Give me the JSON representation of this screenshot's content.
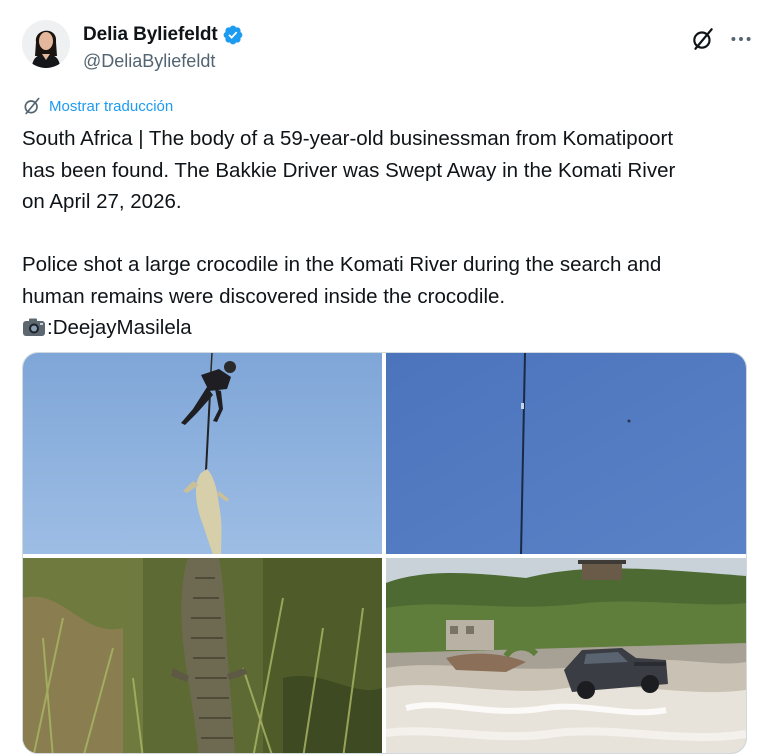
{
  "author": {
    "display_name": "Delia Byliefeldt",
    "handle": "@DeliaByliefeldt",
    "verified": true,
    "verified_color": "#1d9bf0"
  },
  "actions": {
    "grok_icon": "grok-icon",
    "more_icon": "more-icon"
  },
  "translate": {
    "label": "Mostrar traducción",
    "icon": "translate-icon",
    "color": "#1d9bf0"
  },
  "tweet": {
    "lines": [
      "South Africa | The body of a 59-year-old businessman from Komatipoort",
      "has been found.  The Bakkie Driver was Swept Away in the Komati River",
      "on April 27, 2026.",
      "Police shot a large crocodile in the Komati River during the search and",
      "human remains were discovered inside the crocodile."
    ],
    "credit_icon": "camera-icon",
    "credit": ":DeejayMasilela"
  },
  "media": {
    "count": 4,
    "images": [
      {
        "icon": "photo-crocodile-airlift"
      },
      {
        "icon": "photo-sky-cable"
      },
      {
        "icon": "photo-crocodile-in-grass"
      },
      {
        "icon": "photo-bakkie-in-river"
      }
    ]
  }
}
